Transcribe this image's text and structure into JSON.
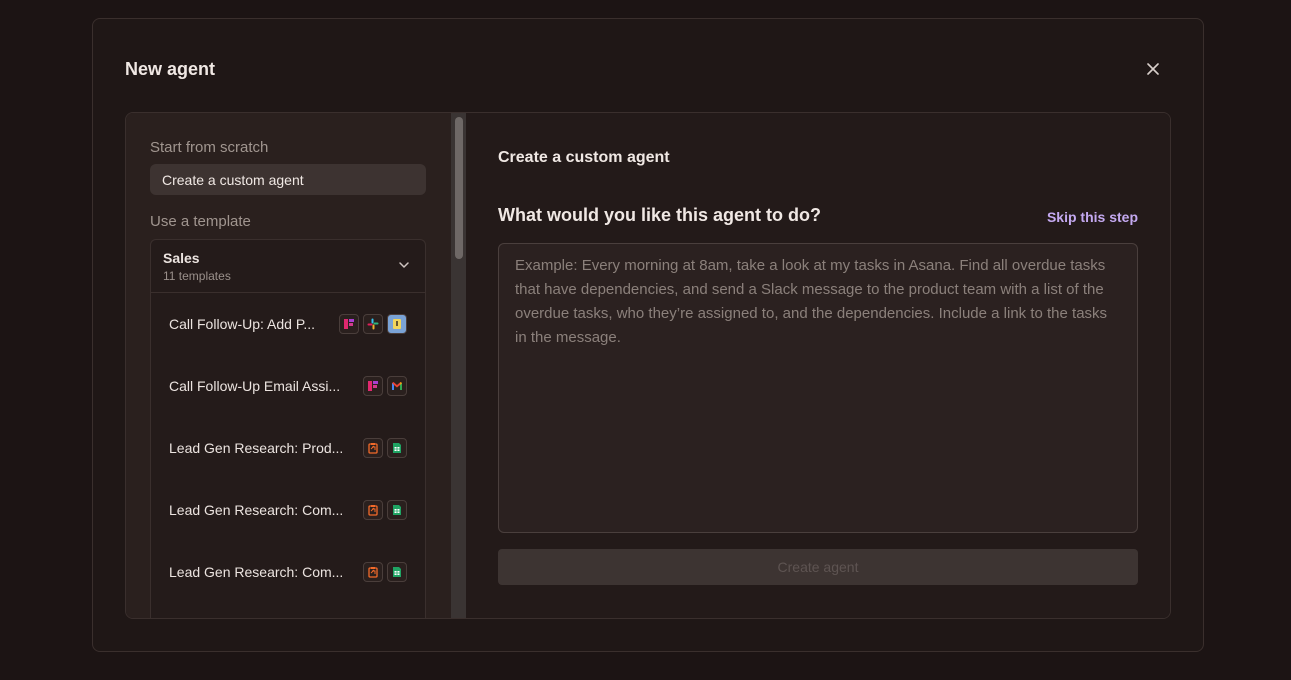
{
  "modal": {
    "title": "New agent",
    "close_icon": "close-icon"
  },
  "sidebar": {
    "scratch_heading": "Start from scratch",
    "scratch_item": "Create a custom agent",
    "template_heading": "Use a template",
    "group": {
      "name": "Sales",
      "count": "11 templates"
    },
    "templates": [
      {
        "label": "Call Follow-Up: Add P...",
        "icons": [
          "fireflies-icon",
          "slack-icon",
          "notepad-icon"
        ]
      },
      {
        "label": "Call Follow-Up Email Assi...",
        "icons": [
          "fireflies-icon",
          "gmail-icon"
        ]
      },
      {
        "label": "Lead Gen Research: Prod...",
        "icons": [
          "clipboard-icon",
          "google-sheets-icon"
        ]
      },
      {
        "label": "Lead Gen Research: Com...",
        "icons": [
          "clipboard-icon",
          "google-sheets-icon"
        ]
      },
      {
        "label": "Lead Gen Research: Com...",
        "icons": [
          "clipboard-icon",
          "google-sheets-icon"
        ]
      }
    ]
  },
  "main": {
    "title": "Create a custom agent",
    "question": "What would you like this agent to do?",
    "skip": "Skip this step",
    "placeholder": "Example: Every morning at 8am, take a look at my tasks in Asana. Find all overdue tasks that have dependencies, and send a Slack message to the product team with a list of the overdue tasks, who they’re assigned to, and the dependencies. Include a link to the tasks in the message.",
    "create_button": "Create agent"
  },
  "colors": {
    "background": "#1c1414",
    "accent_link": "#c4a9f0",
    "fireflies": "#c0266c",
    "sheets": "#1fa463"
  }
}
